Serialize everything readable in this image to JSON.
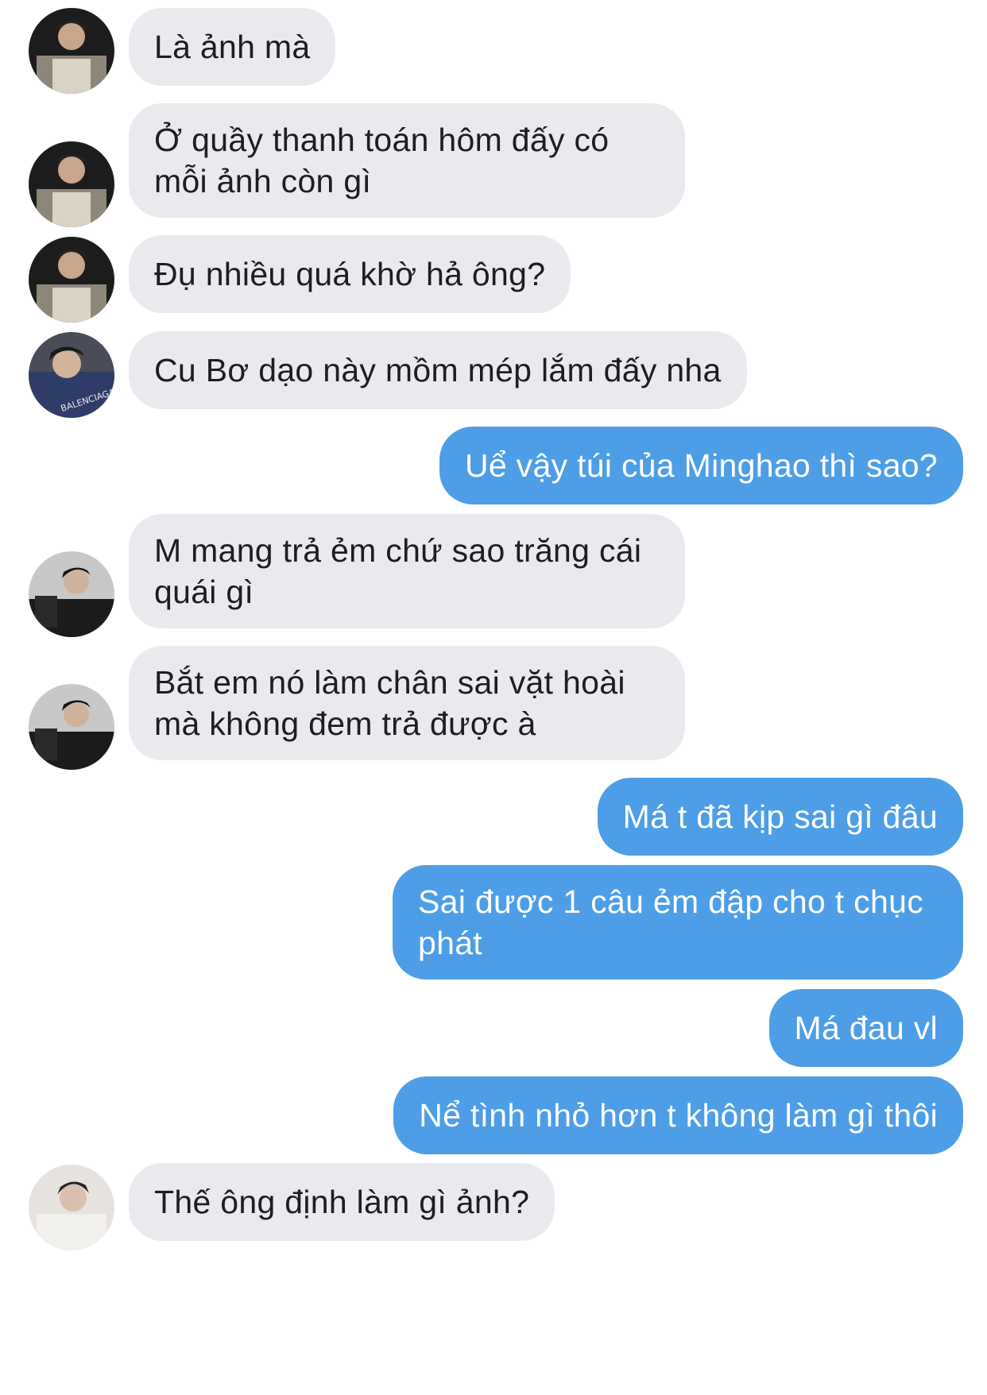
{
  "messages": [
    {
      "side": "in",
      "avatar": "avatar-a",
      "text": "Là ảnh mà"
    },
    {
      "side": "in",
      "avatar": "avatar-a",
      "text": "Ở quầy thanh toán hôm đấy có mỗi ảnh còn gì"
    },
    {
      "side": "in",
      "avatar": "avatar-a",
      "text": "Đụ nhiều quá khờ hả ông?"
    },
    {
      "side": "in",
      "avatar": "avatar-b",
      "text": "Cu Bơ dạo này mồm mép lắm đấy nha"
    },
    {
      "side": "out",
      "text": "Uể vậy túi của Minghao thì sao?"
    },
    {
      "side": "in",
      "avatar": "avatar-c",
      "text": "M mang trả ẻm chứ sao trăng cái quái gì"
    },
    {
      "side": "in",
      "avatar": "avatar-c",
      "text": "Bắt em nó làm chân sai vặt hoài mà không đem trả được à"
    },
    {
      "side": "out",
      "text": "Má t đã kịp sai gì đâu"
    },
    {
      "side": "out",
      "text": "Sai được 1 câu ẻm đập cho t chục phát"
    },
    {
      "side": "out",
      "text": "Má đau vl"
    },
    {
      "side": "out",
      "text": "Nể tình nhỏ hơn t không làm gì thôi"
    },
    {
      "side": "in",
      "avatar": "avatar-d",
      "text": "Thế ông định làm gì ảnh?"
    }
  ],
  "avatar_printed_text": {
    "avatar-b": "BALENCIAGA"
  },
  "colors": {
    "incoming_bubble": "#e9eaed",
    "outgoing_bubble": "#4d9ee6",
    "incoming_text": "#1c1e21",
    "outgoing_text": "#ffffff"
  }
}
